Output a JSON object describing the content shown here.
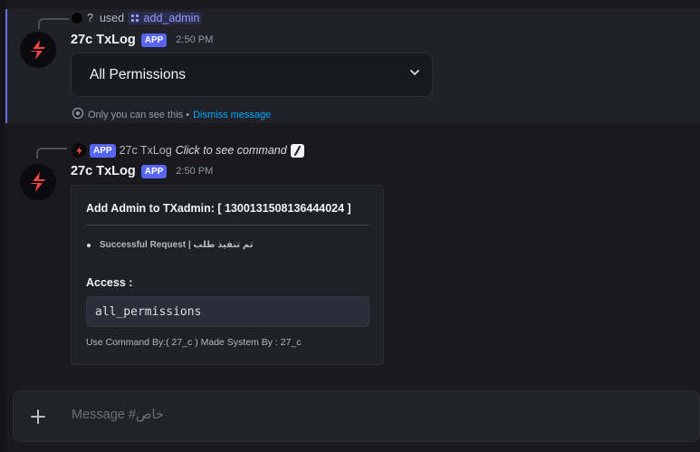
{
  "messages": [
    {
      "reply": {
        "question": "?",
        "used_text": "used",
        "command": "add_admin"
      },
      "author": "27c TxLog",
      "badge": "APP",
      "time": "2:50 PM",
      "select": {
        "value": "All Permissions"
      },
      "ephemeral": {
        "text": "Only you can see this •",
        "dismiss": "Dismiss message"
      }
    },
    {
      "reply": {
        "badge": "APP",
        "author": "27c TxLog",
        "text": "Click to see command"
      },
      "author": "27c TxLog",
      "badge": "APP",
      "time": "2:50 PM",
      "embed": {
        "title": "Add Admin to TXadmin: [ 1300131508136444024 ]",
        "bullet": "Successful Request | تم تنفيذ طلب",
        "field_name": "Access :",
        "field_value": "all_permissions",
        "footer": "Use Command By:( 27_c ) Made System By : 27_c"
      }
    }
  ],
  "composer": {
    "placeholder": "Message #خاص"
  },
  "colors": {
    "accent": "#5865f2",
    "link": "#00a8fc",
    "brand_bolt": "#ef4444",
    "highlight_border": "#6b6fe8"
  },
  "icons": {
    "avatar": "red-lightning-bolt-logo",
    "dropdown": "chevron-down-icon",
    "ephemeral": "eye-icon",
    "command": "slash-command-icon",
    "add": "plus-icon"
  }
}
